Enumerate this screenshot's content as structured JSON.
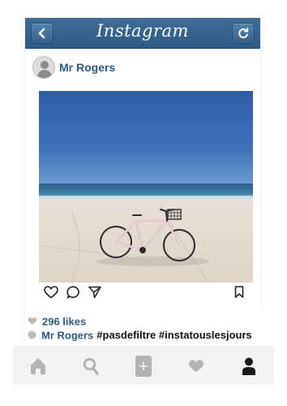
{
  "header": {
    "title": "Instagram",
    "back_icon": "chevron-left-icon",
    "refresh_icon": "refresh-icon"
  },
  "post": {
    "username": "Mr Rogers",
    "photo_description_icon": "bicycle-on-beach-photo",
    "actions": [
      "heart-icon",
      "comment-icon",
      "share-icon",
      "bookmark-icon"
    ],
    "likes": "296 likes",
    "caption_user": "Mr Rogers",
    "caption_text": "#pasdefiltre #instatouslesjours"
  },
  "tabbar": {
    "items": [
      "home-icon",
      "search-icon",
      "add-icon",
      "heart-icon",
      "profile-icon"
    ]
  },
  "colors": {
    "header": "#2b5b87",
    "username": "#2e5b85",
    "tab_inactive": "#b3b3b3",
    "tab_active": "#1a1a1a"
  }
}
